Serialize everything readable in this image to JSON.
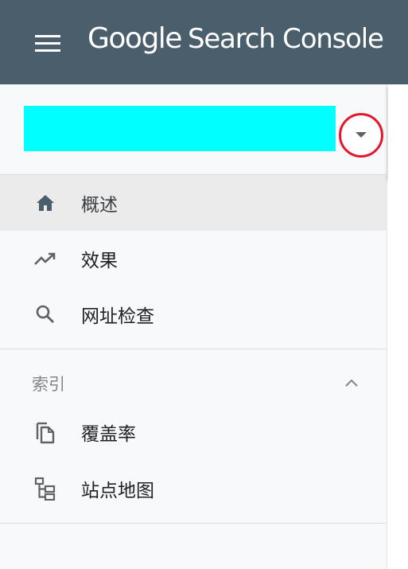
{
  "header": {
    "brand_google": "Google",
    "brand_product": "Search Console",
    "background": "#4a5e6c"
  },
  "property": {
    "selector_color": "#00ffff",
    "dropdown_highlight_color": "#e6162a"
  },
  "nav": {
    "main_items": [
      {
        "label": "概述",
        "icon": "home-icon",
        "active": true
      },
      {
        "label": "效果",
        "icon": "trending-up-icon",
        "active": false
      },
      {
        "label": "网址检查",
        "icon": "search-icon",
        "active": false
      }
    ],
    "index_section": {
      "title": "索引",
      "expanded": true,
      "items": [
        {
          "label": "覆盖率",
          "icon": "copy-pages-icon"
        },
        {
          "label": "站点地图",
          "icon": "sitemap-icon"
        }
      ]
    }
  }
}
